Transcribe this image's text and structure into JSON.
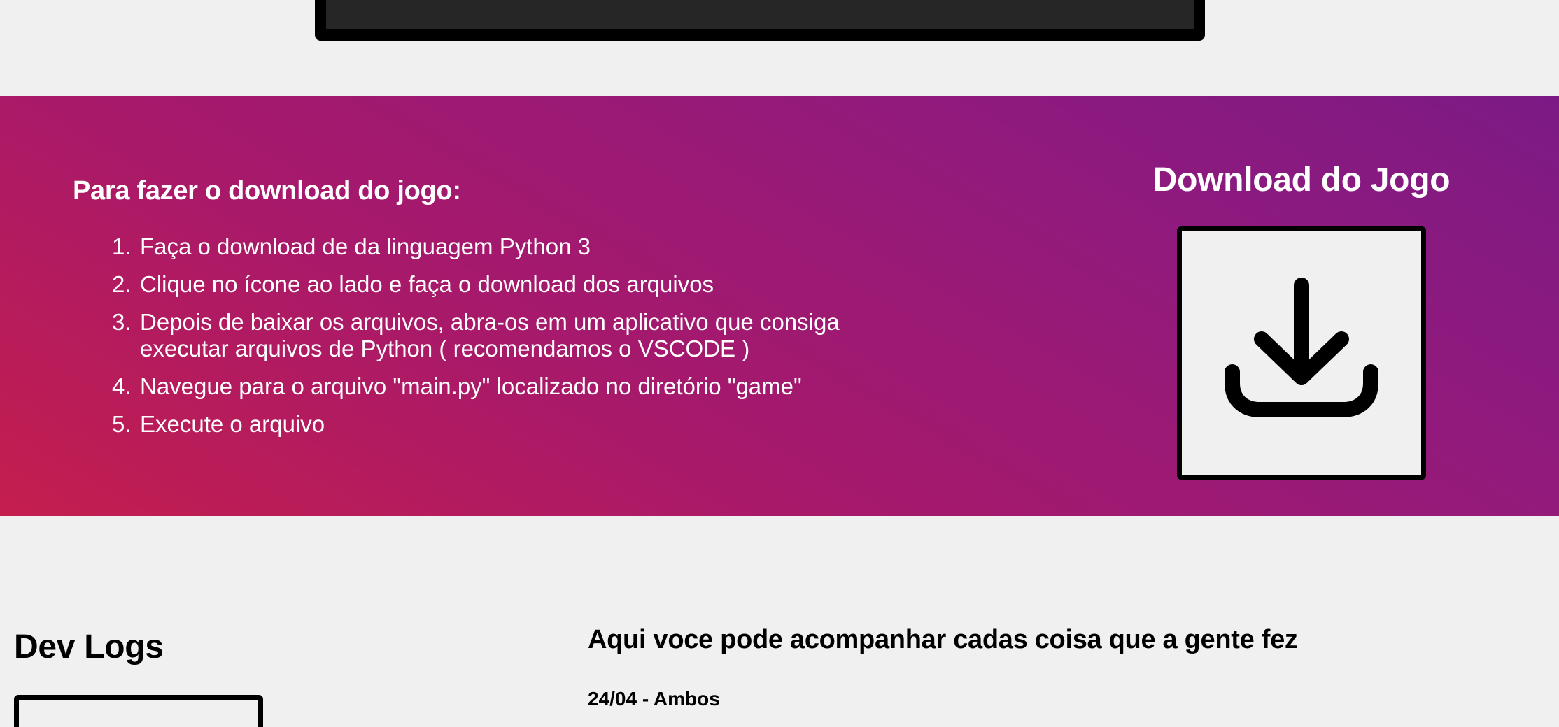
{
  "download_section": {
    "heading": "Para fazer o download do jogo:",
    "steps": [
      {
        "num": "1.",
        "text": "Faça o download de da linguagem Python 3"
      },
      {
        "num": "2.",
        "text": "Clique no ícone ao lado e faça o download dos arquivos"
      },
      {
        "num": "3.",
        "text": "Depois de baixar os arquivos, abra-os em um aplicativo que consiga executar arquivos de Python ( recomendamos o VSCODE )"
      },
      {
        "num": "4.",
        "text": "Navegue para o arquivo \"main.py\" localizado no diretório \"game\""
      },
      {
        "num": "5.",
        "text": "Execute o arquivo"
      }
    ],
    "download_title": "Download do Jogo",
    "download_icon": "download-icon",
    "gradient_colors": [
      "#c41e4e",
      "#a8196a",
      "#921a7c",
      "#7c1a85"
    ]
  },
  "devlogs": {
    "title": "Dev Logs",
    "intro": "Aqui voce pode acompanhar cadas coisa que a gente fez",
    "entries": [
      {
        "title": "24/04 - Ambos"
      }
    ]
  }
}
